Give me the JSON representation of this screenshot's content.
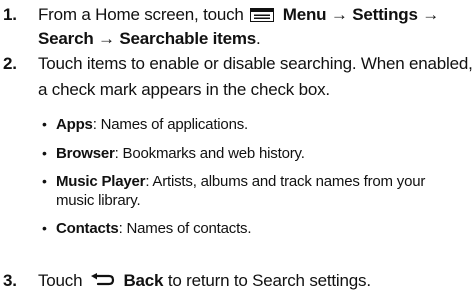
{
  "steps": [
    {
      "number": "1.",
      "text_a": "From a Home screen, touch",
      "menu_label": "Menu",
      "arrow1": "→",
      "settings_label": "Settings",
      "arrow2": "→",
      "search_label": "Search",
      "arrow3": "→",
      "searchable_label": "Searchable items",
      "period": ".",
      "icon": "menu-icon"
    },
    {
      "number": "2.",
      "line1": "Touch items to enable or disable searching. When enabled,",
      "line2": "a check mark appears in the check box.",
      "bullets": [
        {
          "term": "Apps",
          "desc": ": Names of applications."
        },
        {
          "term": "Browser",
          "desc": ": Bookmarks and web history."
        },
        {
          "term": "Music Player",
          "desc": ": Artists, albums and track names from your music library."
        },
        {
          "term": "Contacts",
          "desc": ": Names of contacts."
        }
      ]
    },
    {
      "number": "3.",
      "text_a": "Touch",
      "back_label": "Back",
      "text_b": "to return to Search settings.",
      "icon": "back-arrow-icon"
    }
  ],
  "bullet_glyph": "•"
}
